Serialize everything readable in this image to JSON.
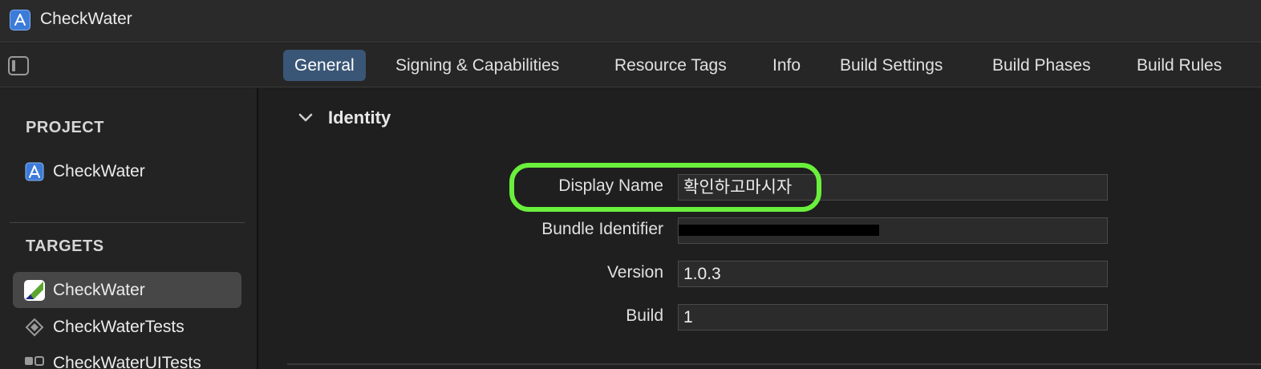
{
  "window": {
    "title": "CheckWater",
    "app_icon": "xcode-app-icon"
  },
  "tabs": [
    {
      "label": "General",
      "active": true
    },
    {
      "label": "Signing & Capabilities",
      "active": false
    },
    {
      "label": "Resource Tags",
      "active": false
    },
    {
      "label": "Info",
      "active": false
    },
    {
      "label": "Build Settings",
      "active": false
    },
    {
      "label": "Build Phases",
      "active": false
    },
    {
      "label": "Build Rules",
      "active": false
    }
  ],
  "sidebar": {
    "project_header": "PROJECT",
    "project_item": "CheckWater",
    "targets_header": "TARGETS",
    "targets": [
      {
        "label": "CheckWater",
        "selected": true,
        "icon": "app-target-icon"
      },
      {
        "label": "CheckWaterTests",
        "selected": false,
        "icon": "unit-test-target-icon"
      },
      {
        "label": "CheckWaterUITests",
        "selected": false,
        "icon": "ui-test-target-icon"
      }
    ]
  },
  "identity": {
    "section_title": "Identity",
    "fields": [
      {
        "label": "Display Name",
        "value": "확인하고마시자"
      },
      {
        "label": "Bundle Identifier",
        "value": "",
        "redacted": true
      },
      {
        "label": "Version",
        "value": "1.0.3"
      },
      {
        "label": "Build",
        "value": "1"
      }
    ]
  },
  "colors": {
    "highlight": "#6af03c",
    "active_tab": "#3a5676",
    "app_icon": "#3d7bd9"
  }
}
